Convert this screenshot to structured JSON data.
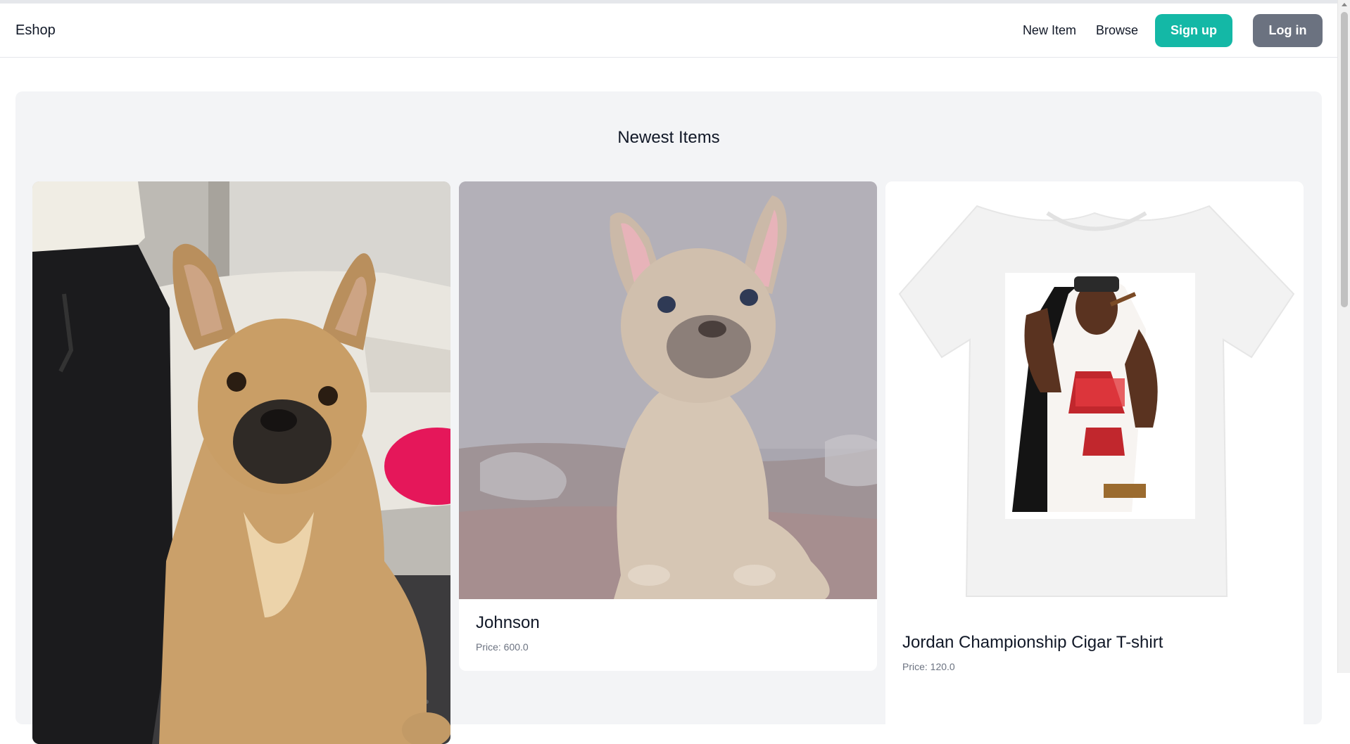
{
  "navbar": {
    "brand": "Eshop",
    "links": [
      "New Item",
      "Browse"
    ],
    "signup_label": "Sign up",
    "login_label": "Log in"
  },
  "main": {
    "title": "Newest Items",
    "items": [
      {
        "name": "",
        "price": ""
      },
      {
        "name": "Johnson",
        "price": "Price: 600.0"
      },
      {
        "name": "Jordan Championship Cigar T-shirt",
        "price": "Price: 120.0"
      }
    ]
  },
  "colors": {
    "signup": "#14b8a6",
    "login": "#6b7280",
    "panel": "#f3f4f6"
  }
}
